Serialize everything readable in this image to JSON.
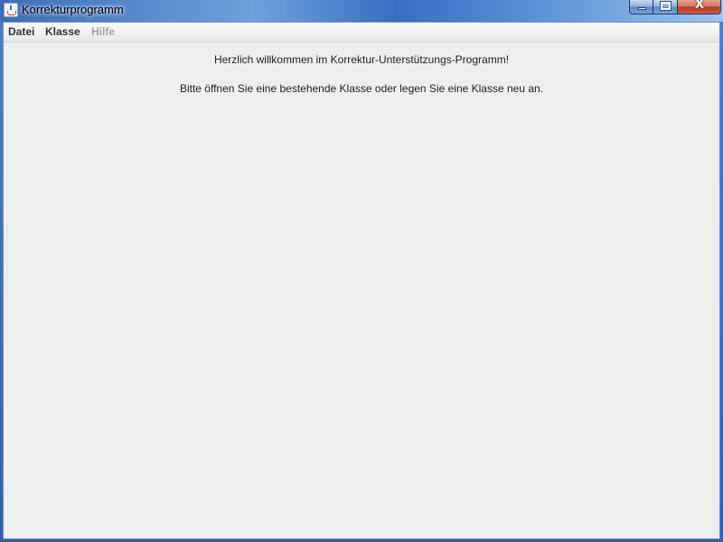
{
  "window": {
    "title": "Korrekturprogramm",
    "controls": {
      "minimize_icon": "minimize-icon",
      "maximize_icon": "maximize-icon",
      "close_icon": "close-icon",
      "close_glyph": "X"
    }
  },
  "menubar": {
    "items": [
      {
        "label": "Datei",
        "enabled": true
      },
      {
        "label": "Klasse",
        "enabled": true
      },
      {
        "label": "Hilfe",
        "enabled": false
      }
    ]
  },
  "main": {
    "welcome_text": "Herzlich willkommen im Korrektur-Unterstützungs-Programm!",
    "instruction_text": "Bitte öffnen Sie eine bestehende Klasse oder legen Sie eine Klasse neu an."
  },
  "colors": {
    "titlebar_accent": "#3b6db8",
    "client_background": "#eeeeee",
    "disabled_menu_text": "#a3a3a3"
  }
}
